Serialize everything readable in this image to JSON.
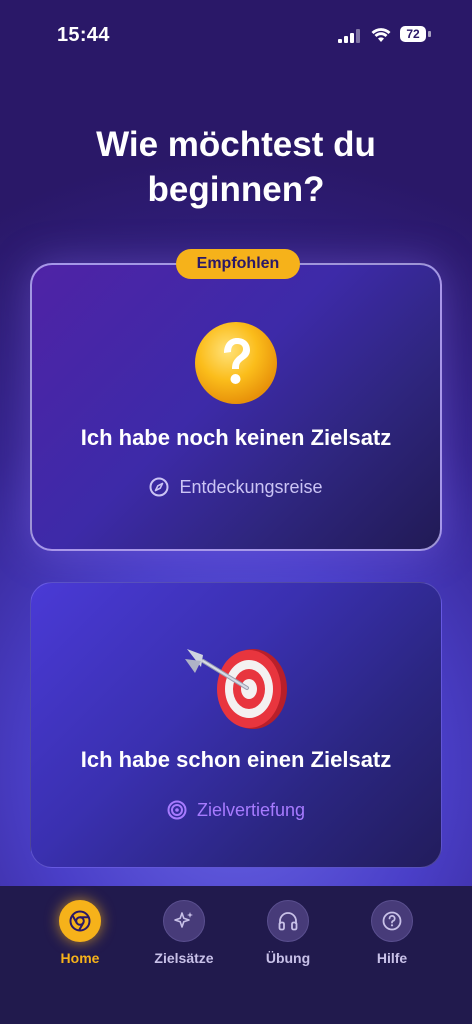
{
  "status_bar": {
    "time": "15:44",
    "battery": "72"
  },
  "page": {
    "title": "Wie möchtest du beginnen?"
  },
  "options": [
    {
      "badge": "Empfohlen",
      "title": "Ich habe noch keinen Zielsatz",
      "subtitle": "Entdeckungsreise",
      "icon": "question-mark-icon",
      "subtitle_icon": "compass-icon"
    },
    {
      "title": "Ich habe schon einen Zielsatz",
      "subtitle": "Zielvertiefung",
      "icon": "dart-target-icon",
      "subtitle_icon": "target-rings-icon"
    }
  ],
  "tabbar": {
    "active": "Home",
    "items": [
      {
        "label": "Home",
        "icon": "chrome-home-icon"
      },
      {
        "label": "Zielsätze",
        "icon": "sparkle-icon"
      },
      {
        "label": "Übung",
        "icon": "headphones-icon"
      },
      {
        "label": "Hilfe",
        "icon": "help-circle-icon"
      }
    ]
  },
  "colors": {
    "accent": "#f6b21a",
    "background": "#35248e",
    "tabbar": "#211a4d",
    "subtitle_purple": "#a77bff"
  }
}
